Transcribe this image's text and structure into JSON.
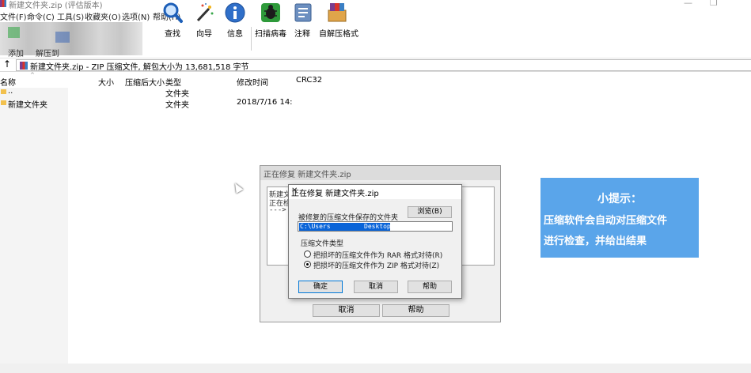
{
  "window": {
    "title": "新建文件夹.zip (评估版本)"
  },
  "menu": [
    "文件(F)",
    "命令(C)",
    "工具(S)",
    "收藏夹(O)",
    "选项(N)",
    "帮助(H)"
  ],
  "toolbar": {
    "blurred_labels": [
      "添加",
      "解压到"
    ],
    "items": [
      {
        "label": "查找",
        "icon": "find-icon"
      },
      {
        "label": "向导",
        "icon": "wizard-icon"
      },
      {
        "label": "信息",
        "icon": "info-icon"
      },
      {
        "label": "扫描病毒",
        "icon": "virus-scan-icon"
      },
      {
        "label": "注释",
        "icon": "comment-icon"
      },
      {
        "label": "自解压格式",
        "icon": "sfx-icon"
      }
    ]
  },
  "address": {
    "path": "新建文件夹.zip - ZIP 压缩文件, 解包大小为 13,681,518 字节"
  },
  "columns": [
    "名称",
    "大小",
    "压缩后大小",
    "类型",
    "修改时间",
    "CRC32"
  ],
  "rows": [
    {
      "name": "..",
      "type": "文件夹",
      "modified": ""
    },
    {
      "name": "新建文件夹",
      "type": "文件夹",
      "modified": "2018/7/16 14:"
    }
  ],
  "back_dialog": {
    "title": "正在修复 新建文件夹.zip",
    "log": [
      "新建文",
      "正在检",
      "---> Z"
    ],
    "cancel_label": "取消",
    "help_label": "帮助"
  },
  "repair_dialog": {
    "title": "正在修复 新建文件夹.zip",
    "save_folder_label": "被修复的压缩文件保存的文件夹",
    "browse_label": "浏览(B)",
    "path_value": "C:\\Users\\██████\\Desktop",
    "path_visible_start": "C:\\Users",
    "path_visible_end": "Desktop",
    "type_label": "压缩文件类型",
    "option_rar": "把损坏的压缩文件作为 RAR 格式对待(R)",
    "option_zip": "把损坏的压缩文件作为 ZIP 格式对待(Z)",
    "selected": "zip",
    "ok_label": "确定",
    "cancel_label": "取消",
    "help_label": "帮助"
  },
  "tip": {
    "title": "小提示：",
    "line1": "压缩软件会自动对压缩文件",
    "line2": "进行检查，并给出结果",
    "bg": "#5aa5ea"
  }
}
